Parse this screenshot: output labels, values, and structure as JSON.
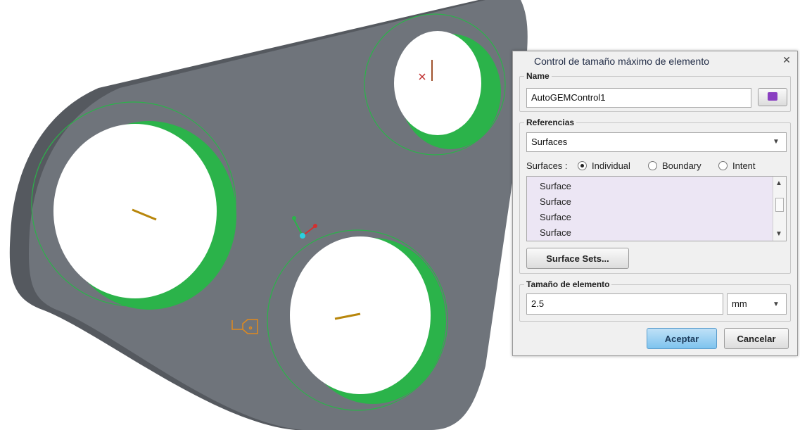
{
  "dialog": {
    "title": "Control de tamaño máximo de elemento",
    "close_icon": "close-icon",
    "name_group": {
      "legend": "Name",
      "value": "AutoGEMControl1",
      "color_icon": "color-swatch-icon"
    },
    "references": {
      "legend": "Referencias",
      "selected": "Surfaces",
      "surfaces_label": "Surfaces :",
      "options": [
        "Individual",
        "Boundary",
        "Intent"
      ],
      "selected_option": "Individual",
      "items": [
        "Surface",
        "Surface",
        "Surface",
        "Surface"
      ],
      "surface_sets_button": "Surface Sets..."
    },
    "element_size": {
      "legend": "Tamaño de elemento",
      "value": "2.5",
      "unit": "mm"
    },
    "buttons": {
      "accept": "Aceptar",
      "cancel": "Cancelar"
    }
  },
  "colors": {
    "part": "#6f747b",
    "part_side": "#55595f",
    "highlight": "#2bb34a",
    "dialog_bg": "#f0f0f0",
    "accent": "#7ec3ee",
    "list_bg": "#ece6f4"
  }
}
